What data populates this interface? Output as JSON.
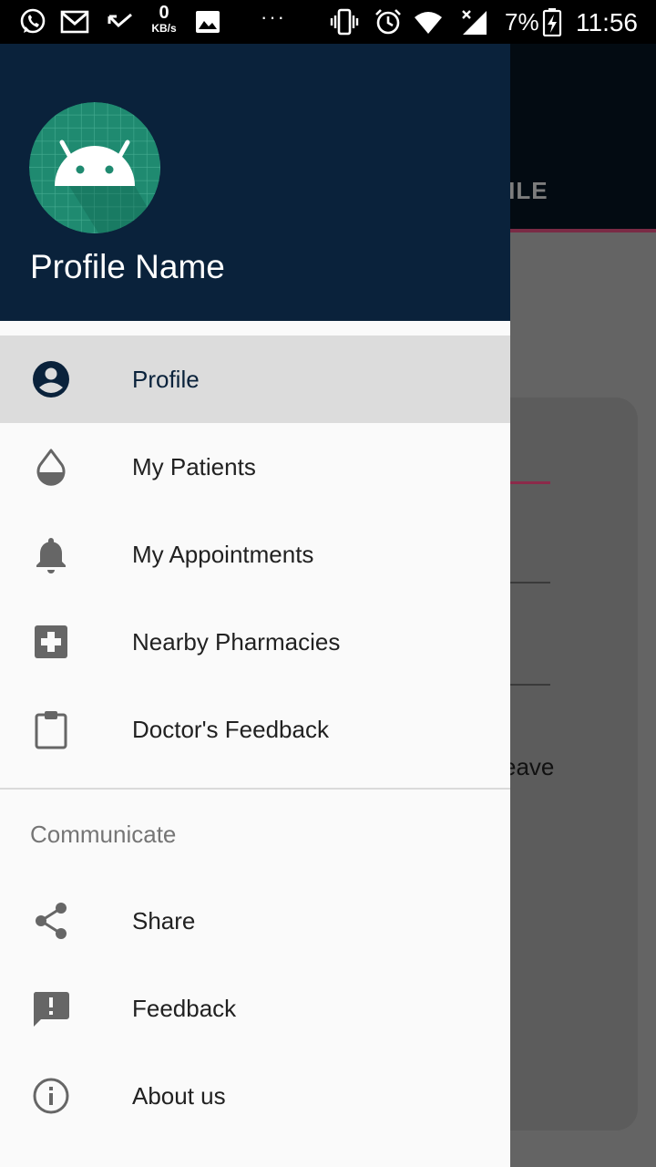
{
  "status_bar": {
    "net_speed_value": "0",
    "net_speed_unit": "KB/s",
    "overflow_dots": "···",
    "battery_percent": "7%",
    "time": "11:56"
  },
  "background_app": {
    "tab_label_partial": "OFILE",
    "leave_text_partial": "eave"
  },
  "drawer": {
    "header": {
      "profile_name": "Profile Name"
    },
    "primary_items": [
      {
        "label": "Profile",
        "icon": "account-circle-icon",
        "selected": true
      },
      {
        "label": "My Patients",
        "icon": "water-drop-icon"
      },
      {
        "label": "My Appointments",
        "icon": "bell-icon"
      },
      {
        "label": "Nearby Pharmacies",
        "icon": "medical-cross-icon"
      },
      {
        "label": "Doctor's Feedback",
        "icon": "clipboard-icon"
      }
    ],
    "section_header": "Communicate",
    "secondary_items": [
      {
        "label": "Share",
        "icon": "share-icon"
      },
      {
        "label": "Feedback",
        "icon": "feedback-icon"
      },
      {
        "label": "About us",
        "icon": "info-icon"
      }
    ]
  },
  "colors": {
    "header_bg": "#0a223b",
    "selected_item_bg": "#dcdcdc",
    "avatar_bg": "#1f8a70",
    "accent_pink": "#8c2a4a"
  }
}
